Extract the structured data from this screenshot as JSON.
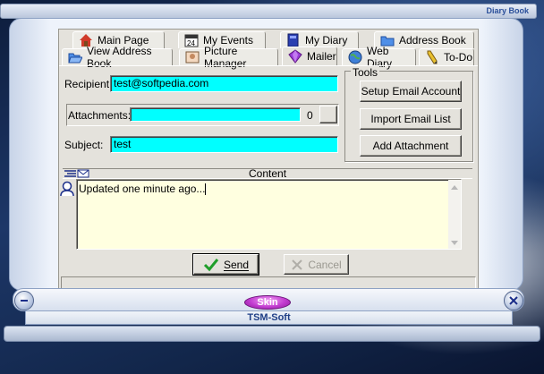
{
  "window": {
    "title": "Diary Book",
    "footer": "TSM-Soft",
    "skin_label": "Skin"
  },
  "tabs_row1": [
    {
      "label": "Main Page",
      "icon": "house-icon"
    },
    {
      "label": "My Events",
      "icon": "calendar-icon"
    },
    {
      "label": "My Diary",
      "icon": "book-icon"
    },
    {
      "label": "Address Book",
      "icon": "folder-icon"
    }
  ],
  "tabs_row2": [
    {
      "label": "View Address Book",
      "icon": "folder-open-icon"
    },
    {
      "label": "Picture Manager",
      "icon": "picture-icon"
    },
    {
      "label": "Mailer",
      "icon": "gem-icon",
      "active": true
    },
    {
      "label": "Web Diary",
      "icon": "globe-icon"
    },
    {
      "label": "To-Do",
      "icon": "pencil-icon"
    }
  ],
  "mailer": {
    "recipient_label": "Recipient:",
    "recipient_value": "test@softpedia.com",
    "attachments_label": "Attachments:",
    "attachments_count": "0",
    "subject_label": "Subject:",
    "subject_value": "test",
    "tools_title": "Tools",
    "tools_buttons": [
      "Setup Email Account",
      "Import Email List",
      "Add Attachment"
    ],
    "content_label": "Content",
    "content_text": "Updated one minute ago...",
    "send_label": "Send",
    "cancel_label": "Cancel"
  },
  "colors": {
    "field_bg": "#00ffff",
    "content_bg": "#ffffe0",
    "accent": "#1f3f86"
  }
}
